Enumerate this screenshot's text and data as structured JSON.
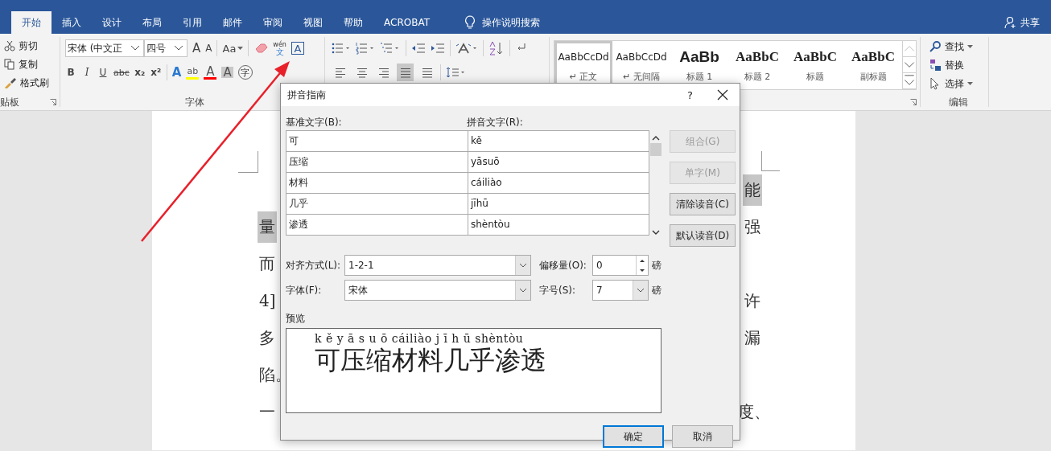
{
  "tabs": [
    {
      "label": "开始",
      "selected": true
    },
    {
      "label": "插入",
      "selected": false
    },
    {
      "label": "设计",
      "selected": false
    },
    {
      "label": "布局",
      "selected": false
    },
    {
      "label": "引用",
      "selected": false
    },
    {
      "label": "邮件",
      "selected": false
    },
    {
      "label": "审阅",
      "selected": false
    },
    {
      "label": "视图",
      "selected": false
    },
    {
      "label": "帮助",
      "selected": false
    },
    {
      "label": "ACROBAT",
      "selected": false
    }
  ],
  "tell_me": "操作说明搜索",
  "share": "共享",
  "clipboard": {
    "items": [
      {
        "label": "剪切",
        "kind": "cut"
      },
      {
        "label": "复制",
        "kind": "copy"
      },
      {
        "label": "格式刷",
        "kind": "brush"
      }
    ],
    "label": "贴板"
  },
  "font": {
    "family": "宋体 (中文正",
    "size": "四号",
    "grow": "A",
    "shrink": "A",
    "case": "Aa",
    "pinyin_top": "wén",
    "pinyin_bottom": "文",
    "border_char": "A",
    "format_buttons": [
      {
        "label": "B",
        "kind": "bold"
      },
      {
        "label": "I",
        "kind": "italic"
      },
      {
        "label": "U",
        "kind": "underline"
      },
      {
        "label": "abc",
        "kind": "strike"
      },
      {
        "label": "x₂",
        "kind": "sub"
      },
      {
        "label": "x²",
        "kind": "sup"
      }
    ],
    "color_buttons": [
      {
        "label": "A",
        "kind": "effect"
      },
      {
        "label": "ab",
        "kind": "highlight",
        "color": "#ffff00"
      },
      {
        "label": "A",
        "kind": "fontcolor",
        "color": "#ff0000"
      },
      {
        "label": "A",
        "kind": "shading"
      }
    ],
    "enclose": "字",
    "label": "字体"
  },
  "paragraph": {
    "alignment_buttons": [
      {
        "kind": "left",
        "selected": false
      },
      {
        "kind": "center",
        "selected": false
      },
      {
        "kind": "right",
        "selected": false
      },
      {
        "kind": "justify",
        "selected": true
      },
      {
        "kind": "distributed",
        "selected": false
      }
    ]
  },
  "styles": [
    {
      "sample": "AaBbCcDd",
      "name": "↵ 正文",
      "kind": "normal",
      "selected": true
    },
    {
      "sample": "AaBbCcDd",
      "name": "↵ 无间隔",
      "kind": "normal",
      "selected": false
    },
    {
      "sample": "AaBb",
      "name": "标题 1",
      "kind": "heading1",
      "selected": false
    },
    {
      "sample": "AaBbC",
      "name": "标题 2",
      "kind": "heading2",
      "selected": false
    },
    {
      "sample": "AaBbC",
      "name": "标题",
      "kind": "title",
      "selected": false
    },
    {
      "sample": "AaBbC",
      "name": "副标题",
      "kind": "subtitle",
      "selected": false
    }
  ],
  "editing": {
    "items": [
      {
        "label": "查找",
        "kind": "find",
        "dropdown": true
      },
      {
        "label": "替换",
        "kind": "replace",
        "dropdown": false
      },
      {
        "label": "选择",
        "kind": "select",
        "dropdown": true
      }
    ],
    "label": "编辑"
  },
  "document": {
    "lines": [
      {
        "right": {
          "text": "能",
          "selected": true
        }
      },
      {
        "left": {
          "text": "量",
          "selected": true
        },
        "right": {
          "text": "强",
          "selected": false
        }
      },
      {
        "left": {
          "text": "而",
          "selected": false
        }
      },
      {
        "left": {
          "text": "4]",
          "selected": false
        },
        "right": {
          "text": "许",
          "selected": false
        }
      },
      {
        "left": {
          "text": "多",
          "selected": false
        },
        "right": {
          "text": "漏",
          "selected": false
        }
      },
      {
        "left": {
          "text": "陷。",
          "selected": false
        }
      },
      {
        "left": {
          "text": "一",
          "selected": false
        },
        "right": {
          "text": "度、",
          "selected": false
        }
      }
    ]
  },
  "dialog": {
    "title": "拼音指南",
    "help": "?",
    "base_label": "基准文字(B):",
    "ruby_label": "拼音文字(R):",
    "rows": [
      {
        "base": "可",
        "ruby": "kě"
      },
      {
        "base": "压缩",
        "ruby": "yāsuō"
      },
      {
        "base": "材料",
        "ruby": "cáiliào"
      },
      {
        "base": "几乎",
        "ruby": "jīhū"
      },
      {
        "base": "渗透",
        "ruby": "shèntòu"
      }
    ],
    "side_buttons": [
      {
        "label": "组合(G)",
        "disabled": true
      },
      {
        "label": "单字(M)",
        "disabled": true
      },
      {
        "label": "清除读音(C)",
        "disabled": false
      },
      {
        "label": "默认读音(D)",
        "disabled": false
      }
    ],
    "alignment": {
      "label": "对齐方式(L):",
      "value": "1-2-1"
    },
    "offset": {
      "label": "偏移量(O):",
      "value": "0",
      "unit": "磅"
    },
    "font": {
      "label": "字体(F):",
      "value": "宋体"
    },
    "size": {
      "label": "字号(S):",
      "value": "7",
      "unit": "磅"
    },
    "preview_label": "预览",
    "preview_ruby": "k ě y ā s u ō cáiliào j ī h ū shèntòu",
    "preview_text": "可压缩材料几乎渗透",
    "buttons": [
      {
        "label": "确定",
        "default": true
      },
      {
        "label": "取消",
        "default": false
      }
    ]
  }
}
